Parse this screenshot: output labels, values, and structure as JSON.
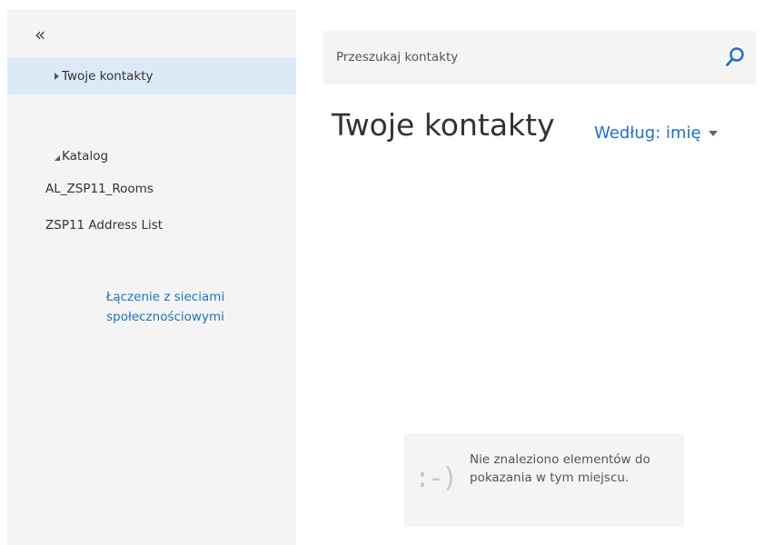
{
  "sidebar": {
    "collapse_label": "«",
    "your_contacts": "Twoje kontakty",
    "catalog": {
      "label": "Katalog",
      "items": [
        "AL_ZSP11_Rooms",
        "ZSP11 Address List"
      ]
    },
    "social_link": "Łączenie z sieciami społecznościowymi"
  },
  "search": {
    "placeholder": "Przeszukaj kontakty"
  },
  "main": {
    "title": "Twoje kontakty",
    "sort_label": "Według: imię"
  },
  "empty_state": {
    "smiley": ":-)",
    "message": "Nie znaleziono elementów do pokazania w tym miejscu."
  },
  "colors": {
    "accent": "#1f6fc1",
    "selected_bg": "#dceaf7",
    "panel_bg": "#f4f4f4"
  },
  "icons": {
    "collapse": "double-chevron-left-icon",
    "search": "search-icon",
    "expand": "triangle-right-icon",
    "collapse_group": "triangle-down-icon",
    "sort": "caret-down-icon"
  }
}
